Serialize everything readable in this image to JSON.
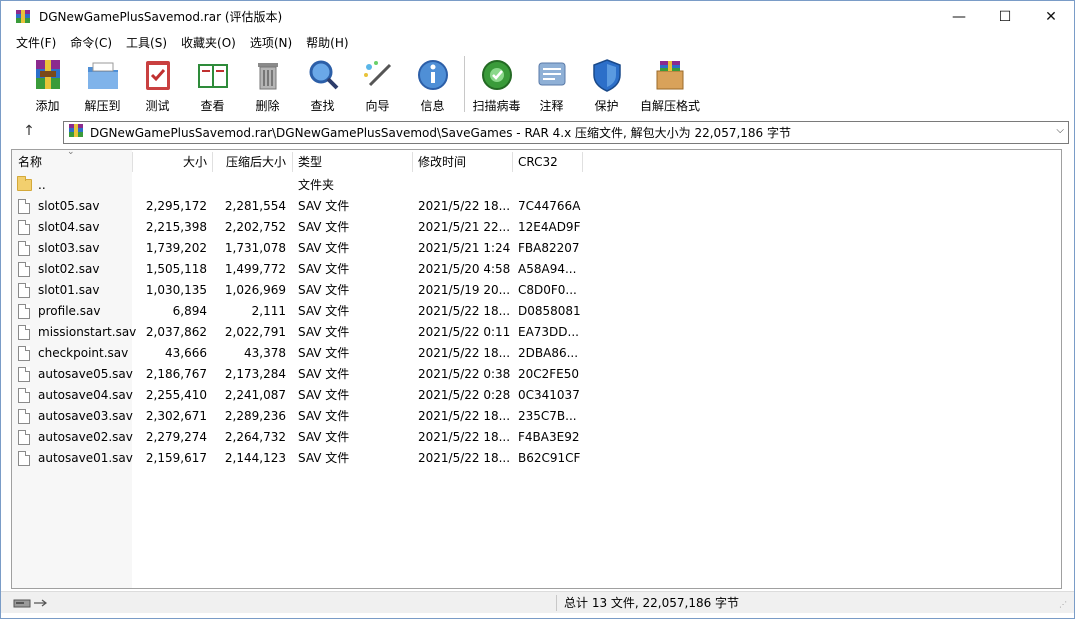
{
  "window": {
    "title": "DGNewGamePlusSavemod.rar (评估版本)",
    "minimize": "—",
    "maximize": "☐",
    "close": "✕"
  },
  "menu": [
    "文件(F)",
    "命令(C)",
    "工具(S)",
    "收藏夹(O)",
    "选项(N)",
    "帮助(H)"
  ],
  "toolbar": [
    {
      "label": "添加",
      "icon": "add-archive-icon"
    },
    {
      "label": "解压到",
      "icon": "extract-to-icon"
    },
    {
      "label": "测试",
      "icon": "test-icon"
    },
    {
      "label": "查看",
      "icon": "view-icon"
    },
    {
      "label": "删除",
      "icon": "delete-icon"
    },
    {
      "label": "查找",
      "icon": "find-icon"
    },
    {
      "label": "向导",
      "icon": "wizard-icon"
    },
    {
      "label": "信息",
      "icon": "info-icon"
    },
    {
      "label": "扫描病毒",
      "icon": "virus-scan-icon"
    },
    {
      "label": "注释",
      "icon": "comment-icon"
    },
    {
      "label": "保护",
      "icon": "protect-icon"
    },
    {
      "label": "自解压格式",
      "icon": "sfx-icon"
    }
  ],
  "address": {
    "path": "DGNewGamePlusSavemod.rar\\DGNewGamePlusSavemod\\SaveGames - RAR 4.x 压缩文件, 解包大小为 22,057,186 字节"
  },
  "columns": [
    "名称",
    "大小",
    "压缩后大小",
    "类型",
    "修改时间",
    "CRC32"
  ],
  "files": [
    {
      "name": "..",
      "size": "",
      "packed": "",
      "type": "文件夹",
      "date": "",
      "crc": "",
      "folder": true
    },
    {
      "name": "slot05.sav",
      "size": "2,295,172",
      "packed": "2,281,554",
      "type": "SAV 文件",
      "date": "2021/5/22 18...",
      "crc": "7C44766A"
    },
    {
      "name": "slot04.sav",
      "size": "2,215,398",
      "packed": "2,202,752",
      "type": "SAV 文件",
      "date": "2021/5/21 22...",
      "crc": "12E4AD9F"
    },
    {
      "name": "slot03.sav",
      "size": "1,739,202",
      "packed": "1,731,078",
      "type": "SAV 文件",
      "date": "2021/5/21 1:24",
      "crc": "FBA82207"
    },
    {
      "name": "slot02.sav",
      "size": "1,505,118",
      "packed": "1,499,772",
      "type": "SAV 文件",
      "date": "2021/5/20 4:58",
      "crc": "A58A94..."
    },
    {
      "name": "slot01.sav",
      "size": "1,030,135",
      "packed": "1,026,969",
      "type": "SAV 文件",
      "date": "2021/5/19 20...",
      "crc": "C8D0F0..."
    },
    {
      "name": "profile.sav",
      "size": "6,894",
      "packed": "2,111",
      "type": "SAV 文件",
      "date": "2021/5/22 18...",
      "crc": "D0858081"
    },
    {
      "name": "missionstart.sav",
      "size": "2,037,862",
      "packed": "2,022,791",
      "type": "SAV 文件",
      "date": "2021/5/22 0:11",
      "crc": "EA73DD..."
    },
    {
      "name": "checkpoint.sav",
      "size": "43,666",
      "packed": "43,378",
      "type": "SAV 文件",
      "date": "2021/5/22 18...",
      "crc": "2DBA86..."
    },
    {
      "name": "autosave05.sav",
      "size": "2,186,767",
      "packed": "2,173,284",
      "type": "SAV 文件",
      "date": "2021/5/22 0:38",
      "crc": "20C2FE50"
    },
    {
      "name": "autosave04.sav",
      "size": "2,255,410",
      "packed": "2,241,087",
      "type": "SAV 文件",
      "date": "2021/5/22 0:28",
      "crc": "0C341037"
    },
    {
      "name": "autosave03.sav",
      "size": "2,302,671",
      "packed": "2,289,236",
      "type": "SAV 文件",
      "date": "2021/5/22 18...",
      "crc": "235C7B..."
    },
    {
      "name": "autosave02.sav",
      "size": "2,279,274",
      "packed": "2,264,732",
      "type": "SAV 文件",
      "date": "2021/5/22 18...",
      "crc": "F4BA3E92"
    },
    {
      "name": "autosave01.sav",
      "size": "2,159,617",
      "packed": "2,144,123",
      "type": "SAV 文件",
      "date": "2021/5/22 18...",
      "crc": "B62C91CF"
    }
  ],
  "status": {
    "summary": "总计 13 文件, 22,057,186 字节"
  }
}
